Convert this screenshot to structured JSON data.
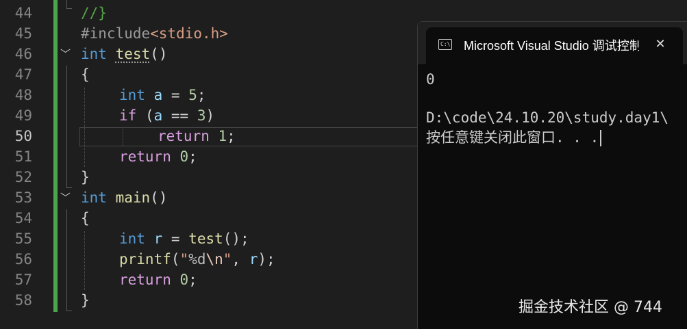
{
  "editor": {
    "lines": [
      {
        "num": "44",
        "code": "//}"
      },
      {
        "num": "45",
        "code": "#include<stdio.h>"
      },
      {
        "num": "46",
        "code": "int test()"
      },
      {
        "num": "47",
        "code": "{"
      },
      {
        "num": "48",
        "code": "int a = 5;"
      },
      {
        "num": "49",
        "code": "if (a == 3)"
      },
      {
        "num": "50",
        "code": "return 1;"
      },
      {
        "num": "51",
        "code": "return 0;"
      },
      {
        "num": "52",
        "code": "}"
      },
      {
        "num": "53",
        "code": "int main()"
      },
      {
        "num": "54",
        "code": "{"
      },
      {
        "num": "55",
        "code": "int r = test();"
      },
      {
        "num": "56",
        "code": "printf(\"%d\\n\", r);"
      },
      {
        "num": "57",
        "code": "return 0;"
      },
      {
        "num": "58",
        "code": "}"
      }
    ],
    "active_line": "50",
    "fold_icons": [
      "chevron-down",
      "chevron-down"
    ]
  },
  "console": {
    "tab_title": "Microsoft Visual Studio 调试控制台",
    "close_glyph": "✕",
    "output_lines": [
      "0",
      "",
      "D:\\code\\24.10.20\\study.day1\\",
      "按任意键关闭此窗口. . ."
    ]
  },
  "watermark": "掘金技术社区 @ 744"
}
